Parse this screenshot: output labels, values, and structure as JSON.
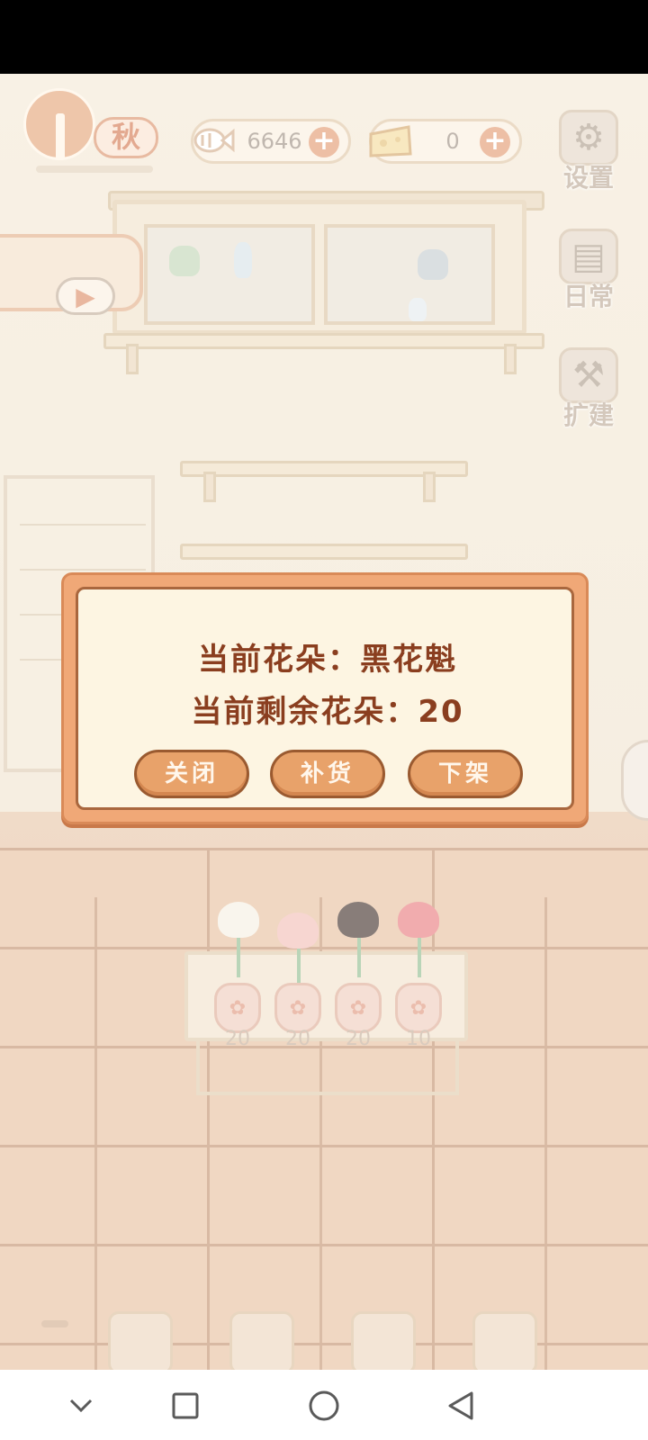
{
  "hud": {
    "season_label": "秋",
    "currencies": [
      {
        "icon": "fishbone-icon",
        "value": "6646"
      },
      {
        "icon": "cheese-icon",
        "value": "0"
      }
    ],
    "side_buttons": [
      {
        "label": "设置",
        "icon": "gear-icon"
      },
      {
        "label": "日常",
        "icon": "notebook-icon"
      },
      {
        "label": "扩建",
        "icon": "tools-icon"
      }
    ]
  },
  "flower_stand": {
    "pots": [
      {
        "count": "20",
        "color": "#f7f2e6"
      },
      {
        "count": "20",
        "color": "#f4c6c0"
      },
      {
        "count": "20",
        "color": "#5a4b46"
      },
      {
        "count": "10",
        "color": "#ec8d8f"
      }
    ]
  },
  "dialog": {
    "current_flower_label": "当前花朵：黑花魁",
    "remaining_label": "当前剩余花朵：20",
    "buttons": {
      "close": "关闭",
      "restock": "补货",
      "remove": "下架"
    }
  },
  "nav": {
    "icons": [
      "chevron-down-icon",
      "square-icon",
      "circle-icon",
      "back-triangle-icon"
    ]
  }
}
